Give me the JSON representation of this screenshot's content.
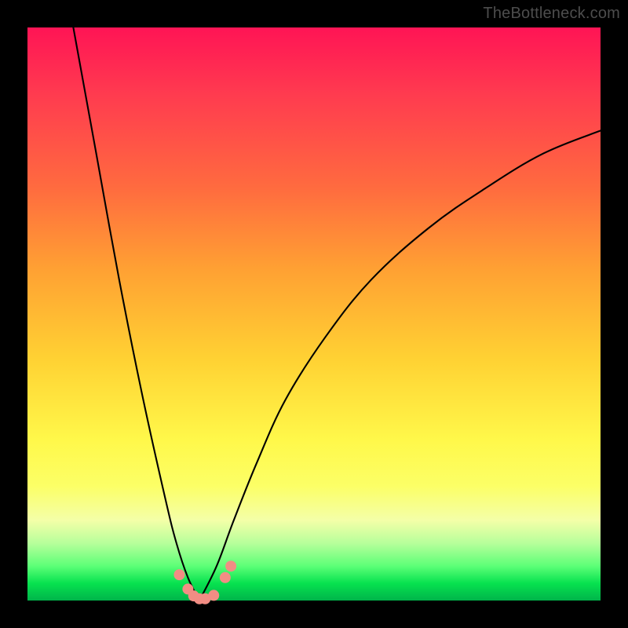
{
  "watermark": "TheBottleneck.com",
  "chart_data": {
    "type": "line",
    "title": "",
    "xlabel": "",
    "ylabel": "",
    "xlim": [
      0,
      100
    ],
    "ylim": [
      0,
      100
    ],
    "note": "Axes are unlabeled; x/y normalized 0–100 to the plot area. Two black curves descend to a common trough near x≈30, y≈0; right curve rises to approximately (100, 82). Small salmon dots cluster near the trough.",
    "series": [
      {
        "name": "left-curve",
        "x": [
          8,
          12,
          16,
          20,
          24,
          26,
          28,
          30
        ],
        "y": [
          100,
          78,
          56,
          36,
          18,
          10,
          4,
          0
        ]
      },
      {
        "name": "right-curve",
        "x": [
          30,
          33,
          36,
          40,
          45,
          52,
          60,
          70,
          80,
          90,
          100
        ],
        "y": [
          0,
          6,
          14,
          24,
          35,
          46,
          56,
          65,
          72,
          78,
          82
        ]
      }
    ],
    "trough_dots": {
      "x": [
        26.5,
        28,
        29,
        30,
        31,
        32.5,
        34.5,
        35.5
      ],
      "y": [
        4.5,
        2.0,
        0.8,
        0.3,
        0.3,
        0.9,
        4.0,
        6.0
      ]
    },
    "colors": {
      "curve": "#000000",
      "dots": "#f28d84",
      "frame": "#000000",
      "gradient_top": "#ff1455",
      "gradient_bottom": "#00b44a"
    }
  }
}
